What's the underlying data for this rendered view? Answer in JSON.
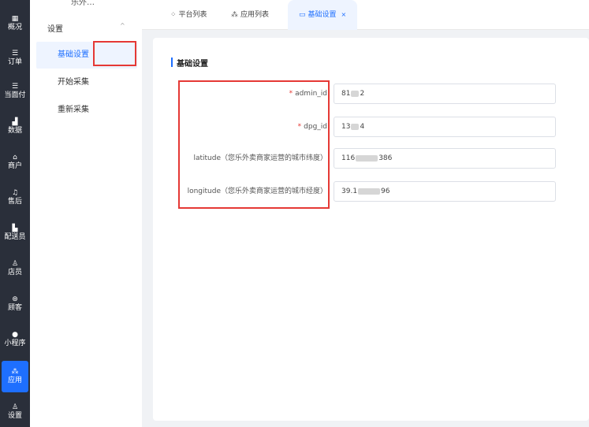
{
  "left_nav": [
    {
      "icon": "▦",
      "label": "概况"
    },
    {
      "icon": "☰",
      "label": "订单"
    },
    {
      "icon": "☰",
      "label": "当面付"
    },
    {
      "icon": "▟",
      "label": "数据"
    },
    {
      "icon": "⌂",
      "label": "商户"
    },
    {
      "icon": "♫",
      "label": "售后"
    },
    {
      "icon": "▙",
      "label": "配送员"
    },
    {
      "icon": "♙",
      "label": "店员"
    },
    {
      "icon": "⊛",
      "label": "顾客"
    },
    {
      "icon": "●",
      "label": "小程序"
    },
    {
      "icon": "⁂",
      "label": "应用"
    },
    {
      "icon": "♙",
      "label": "设置"
    }
  ],
  "sub_sidebar": {
    "top_text": "乐外…",
    "group_label": "设置",
    "group_arrow": "^",
    "items": [
      {
        "label": "基础设置"
      },
      {
        "label": "开始采集"
      },
      {
        "label": "重新采集"
      }
    ]
  },
  "tabs": [
    {
      "icon": "⁘",
      "label": "平台列表"
    },
    {
      "icon": "⁂",
      "label": "应用列表"
    },
    {
      "icon": "▭",
      "label": "基础设置",
      "close": "×"
    }
  ],
  "main": {
    "section_title": "基础设置",
    "fields": [
      {
        "required": "*",
        "label": "admin_id",
        "value_prefix": "81",
        "value_suffix": "2"
      },
      {
        "required": "*",
        "label": "dpg_id",
        "value_prefix": "13",
        "value_suffix": "4"
      },
      {
        "required": "",
        "label": "latitude（您乐外卖商家运营的城市纬度）",
        "value_prefix": "116",
        "value_suffix": "386"
      },
      {
        "required": "",
        "label": "longitude（您乐外卖商家运营的城市经度）",
        "value_prefix": "39.1",
        "value_suffix": "96"
      }
    ]
  },
  "colors": {
    "accent": "#1e6fff",
    "highlight": "#e53935",
    "nav_bg": "#2a2f3a"
  }
}
